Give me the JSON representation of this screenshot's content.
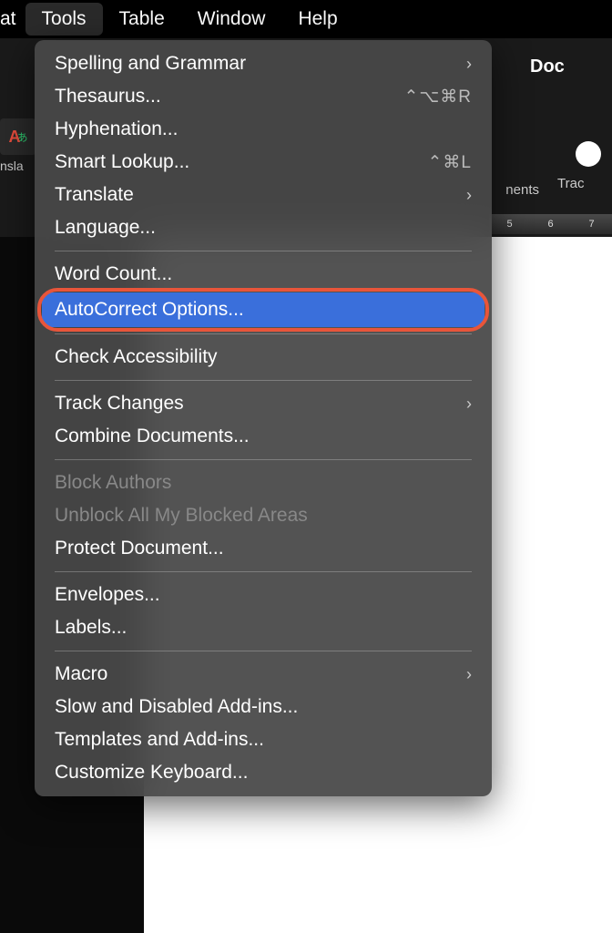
{
  "menubar": {
    "leading": "at",
    "items": [
      "Tools",
      "Table",
      "Window",
      "Help"
    ],
    "active_index": 0
  },
  "background": {
    "doc_label": "Doc",
    "translate_label": "nsla",
    "comments_label": "nents",
    "track_label": "Trac",
    "ruler_marks": [
      "5",
      "6",
      "7"
    ]
  },
  "dropdown": {
    "sections": [
      [
        {
          "label": "Spelling and Grammar",
          "submenu": true
        },
        {
          "label": "Thesaurus...",
          "shortcut": "⌃⌥⌘R"
        },
        {
          "label": "Hyphenation..."
        },
        {
          "label": "Smart Lookup...",
          "shortcut": "⌃⌘L"
        },
        {
          "label": "Translate",
          "submenu": true
        },
        {
          "label": "Language..."
        }
      ],
      [
        {
          "label": "Word Count..."
        },
        {
          "label": "AutoCorrect Options...",
          "highlighted": true
        }
      ],
      [
        {
          "label": "Check Accessibility"
        }
      ],
      [
        {
          "label": "Track Changes",
          "submenu": true
        },
        {
          "label": "Combine Documents..."
        }
      ],
      [
        {
          "label": "Block Authors",
          "disabled": true
        },
        {
          "label": "Unblock All My Blocked Areas",
          "disabled": true
        },
        {
          "label": "Protect Document..."
        }
      ],
      [
        {
          "label": "Envelopes..."
        },
        {
          "label": "Labels..."
        }
      ],
      [
        {
          "label": "Macro",
          "submenu": true
        },
        {
          "label": "Slow and Disabled Add-ins..."
        },
        {
          "label": "Templates and Add-ins..."
        },
        {
          "label": "Customize Keyboard..."
        }
      ]
    ]
  }
}
